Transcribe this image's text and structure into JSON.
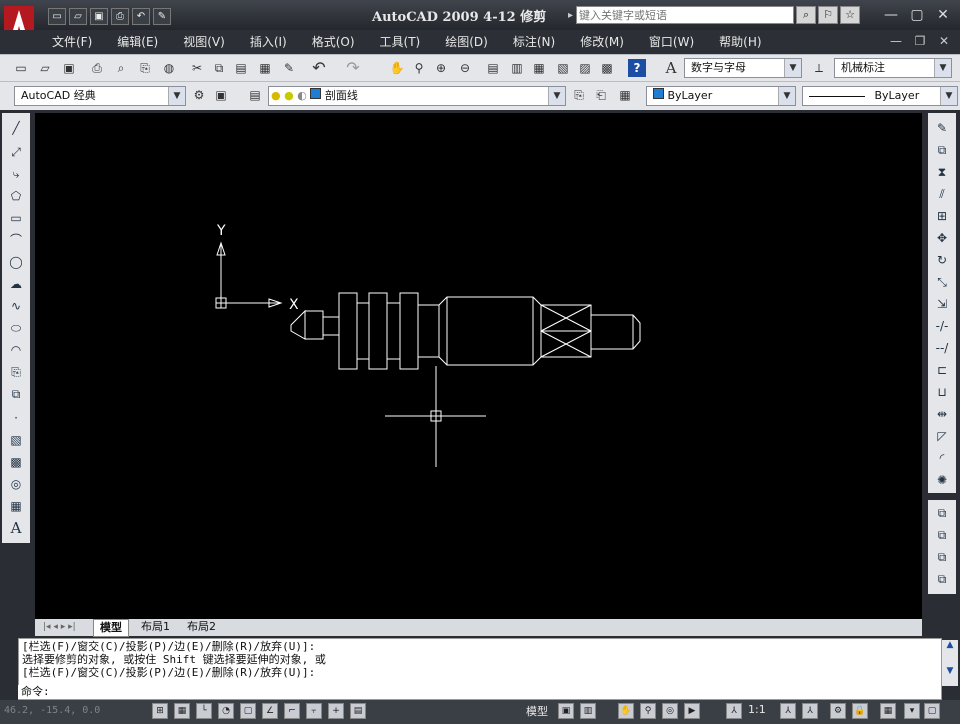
{
  "app": {
    "title": "AutoCAD 2009  4-12 修剪",
    "search_placeholder": "键入关键字或短语"
  },
  "menu": [
    "文件(F)",
    "编辑(E)",
    "视图(V)",
    "插入(I)",
    "格式(O)",
    "工具(T)",
    "绘图(D)",
    "标注(N)",
    "修改(M)",
    "窗口(W)",
    "帮助(H)"
  ],
  "toolbar": {
    "text_style": "数字与字母",
    "dim_style": "机械标注",
    "workspace": "AutoCAD 经典",
    "layer": "剖面线",
    "color": "ByLayer",
    "linetype": "ByLayer"
  },
  "drawing": {
    "ucs_x": "X",
    "ucs_y": "Y"
  },
  "tabs": [
    "模型",
    "布局1",
    "布局2"
  ],
  "command": {
    "line1": "[栏选(F)/窗交(C)/投影(P)/边(E)/删除(R)/放弃(U)]:",
    "line2": "选择要修剪的对象, 或按住 Shift 键选择要延伸的对象, 或",
    "line3": "[栏选(F)/窗交(C)/投影(P)/边(E)/删除(R)/放弃(U)]:",
    "prompt": "命令:"
  },
  "status": {
    "coords": "46.2, -15.4, 0.0",
    "model": "模型",
    "scale": "1:1"
  },
  "colors": {
    "canvas": "#000000",
    "accent": "#c0272d",
    "layer_color": "#1f7dd6"
  }
}
